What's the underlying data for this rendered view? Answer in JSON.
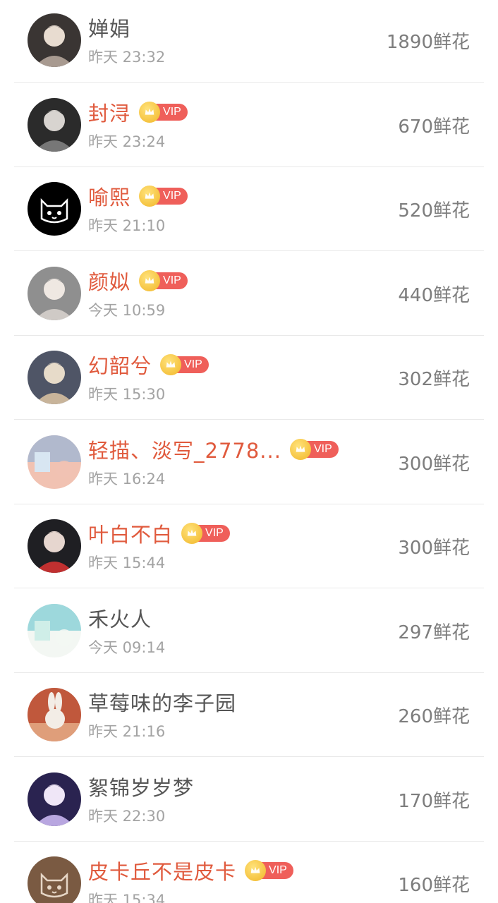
{
  "gift_unit": "鲜花",
  "rows": [
    {
      "name": "婵娟",
      "vip": false,
      "time": "昨天 23:32",
      "amount": "1890鲜花",
      "avatar_colors": [
        "#3a3533",
        "#a89a90",
        "#e8dcd0"
      ],
      "avatar_icon": "portrait-avatar-icon"
    },
    {
      "name": "封浔",
      "vip": true,
      "time": "昨天 23:24",
      "amount": "670鲜花",
      "avatar_colors": [
        "#2b2b2b",
        "#777777",
        "#d8d4d0"
      ],
      "avatar_icon": "portrait-avatar-icon"
    },
    {
      "name": "喻熙",
      "vip": true,
      "time": "昨天 21:10",
      "amount": "520鲜花",
      "avatar_colors": [
        "#000000",
        "#ffffff",
        "#000000"
      ],
      "avatar_icon": "cat-avatar-icon"
    },
    {
      "name": "颜姒",
      "vip": true,
      "time": "今天 10:59",
      "amount": "440鲜花",
      "avatar_colors": [
        "#8f8f8f",
        "#cfcac6",
        "#efe8e2"
      ],
      "avatar_icon": "portrait-avatar-icon"
    },
    {
      "name": "幻韶兮",
      "vip": true,
      "time": "昨天 15:30",
      "amount": "302鲜花",
      "avatar_colors": [
        "#4f5566",
        "#c8b49a",
        "#e7dbc9"
      ],
      "avatar_icon": "portrait-avatar-icon"
    },
    {
      "name": "轻描、淡写_2778...",
      "vip": true,
      "time": "昨天 16:24",
      "amount": "300鲜花",
      "avatar_colors": [
        "#8fb4dc",
        "#d8e6f2",
        "#f1c2b2"
      ],
      "avatar_icon": "scenery-avatar-icon"
    },
    {
      "name": "叶白不白",
      "vip": true,
      "time": "昨天 15:44",
      "amount": "300鲜花",
      "avatar_colors": [
        "#1f1f23",
        "#c03030",
        "#e6d6cf"
      ],
      "avatar_icon": "portrait-avatar-icon"
    },
    {
      "name": "禾火人",
      "vip": false,
      "time": "今天 09:14",
      "amount": "297鲜花",
      "avatar_colors": [
        "#6fc8cf",
        "#cfeee8",
        "#f3f7f3"
      ],
      "avatar_icon": "scenery-avatar-icon"
    },
    {
      "name": "草莓味的李子园",
      "vip": false,
      "time": "昨天 21:16",
      "amount": "260鲜花",
      "avatar_colors": [
        "#c0583c",
        "#e6b08a",
        "#f3ede6"
      ],
      "avatar_icon": "rabbit-avatar-icon"
    },
    {
      "name": "絮锦岁岁梦",
      "vip": false,
      "time": "昨天 22:30",
      "amount": "170鲜花",
      "avatar_colors": [
        "#2a2350",
        "#b8a6e0",
        "#efe6f7"
      ],
      "avatar_icon": "portrait-avatar-icon"
    },
    {
      "name": "皮卡丘不是皮卡",
      "vip": true,
      "time": "昨天 15:34",
      "amount": "160鲜花",
      "avatar_colors": [
        "#7a5a42",
        "#e6d6c6",
        "#ffffff"
      ],
      "avatar_icon": "cat-avatar-icon"
    }
  ],
  "vip_label": "VIP",
  "colors": {
    "vip_name": "#e05a3d",
    "normal_name": "#555555",
    "time": "#a3a3a3",
    "amount": "#7d7d7d",
    "vip_tag": "#ef5f5a",
    "crown": "#f1b628",
    "divider": "#e9e9e9"
  }
}
